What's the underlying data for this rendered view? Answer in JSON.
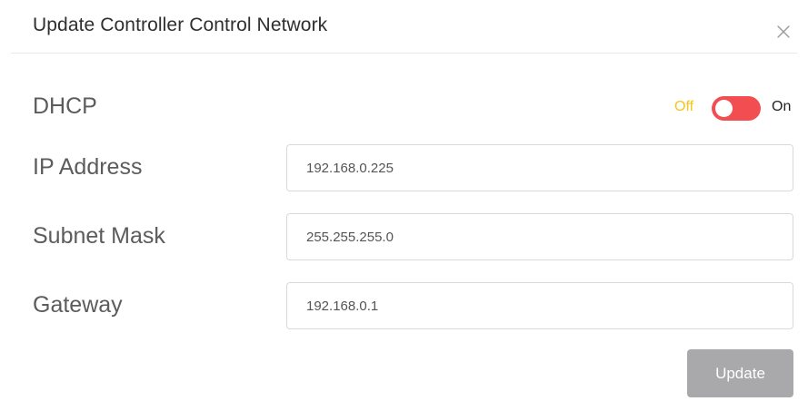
{
  "dialog": {
    "title": "Update Controller Control Network",
    "close_icon": "close-icon"
  },
  "dhcp": {
    "label": "DHCP",
    "toggle_off_label": "Off",
    "toggle_on_label": "On",
    "toggle_state": "off",
    "toggle_color": "#f24d51",
    "off_label_color": "#f5c518"
  },
  "fields": {
    "ip_address": {
      "label": "IP Address",
      "value": "192.168.0.225"
    },
    "subnet_mask": {
      "label": "Subnet Mask",
      "value": "255.255.255.0"
    },
    "gateway": {
      "label": "Gateway",
      "value": "192.168.0.1"
    }
  },
  "actions": {
    "update_label": "Update"
  }
}
